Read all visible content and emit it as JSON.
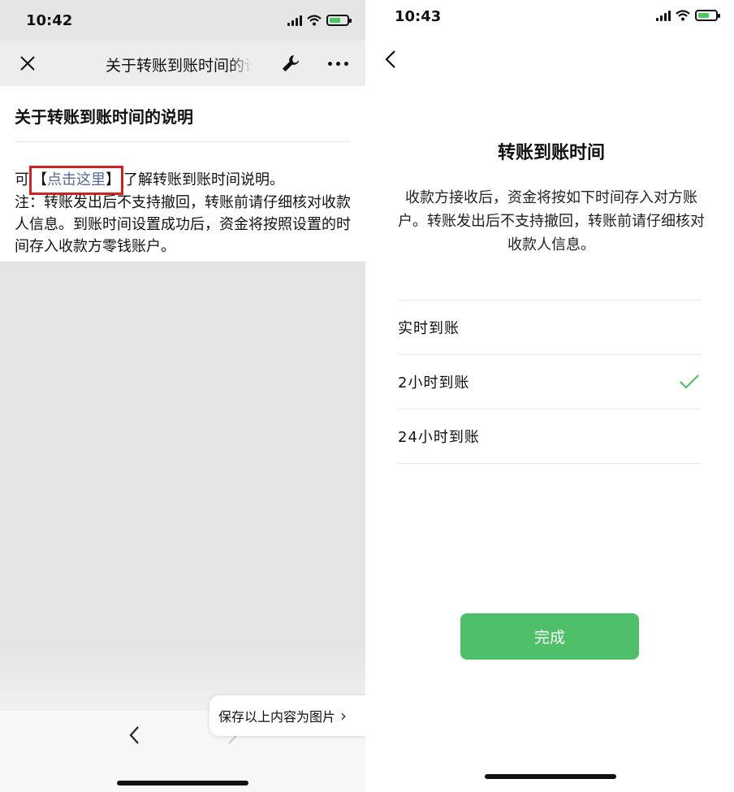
{
  "left": {
    "status_time": "10:42",
    "nav_title": "关于转账到账时间的说明",
    "article": {
      "heading": "关于转账到账时间的说明",
      "prefix": "可",
      "link_open": "【",
      "link_text": "点击这里",
      "link_close": "】",
      "after_link": "了解转账到账时间说明。",
      "note": "注：转账发出后不支持撤回，转账前请仔细核对收款人信息。到账时间设置成功后，资金将按照设置的时间存入收款方零钱账户。"
    },
    "save_image_label": "保存以上内容为图片",
    "save_image_chevron": "›"
  },
  "right": {
    "status_time": "10:43",
    "title": "转账到账时间",
    "description": "收款方接收后，资金将按如下时间存入对方账户。转账发出后不支持撤回，转账前请仔细核对收款人信息。",
    "options": [
      {
        "label": "实时到账",
        "selected": false
      },
      {
        "label": "2小时到账",
        "selected": true
      },
      {
        "label": "24小时到账",
        "selected": false
      }
    ],
    "done_label": "完成"
  },
  "colors": {
    "accent_green": "#4fbf6a",
    "link_blue": "#576b95",
    "highlight_red": "#cc2222",
    "battery_green": "#4cc764"
  },
  "icons": [
    "close-icon",
    "wrench-icon",
    "more-icon",
    "back-chevron-icon",
    "forward-chevron-icon",
    "checkmark-icon",
    "signal-icon",
    "wifi-icon",
    "battery-icon"
  ],
  "battery_level": 0.55
}
